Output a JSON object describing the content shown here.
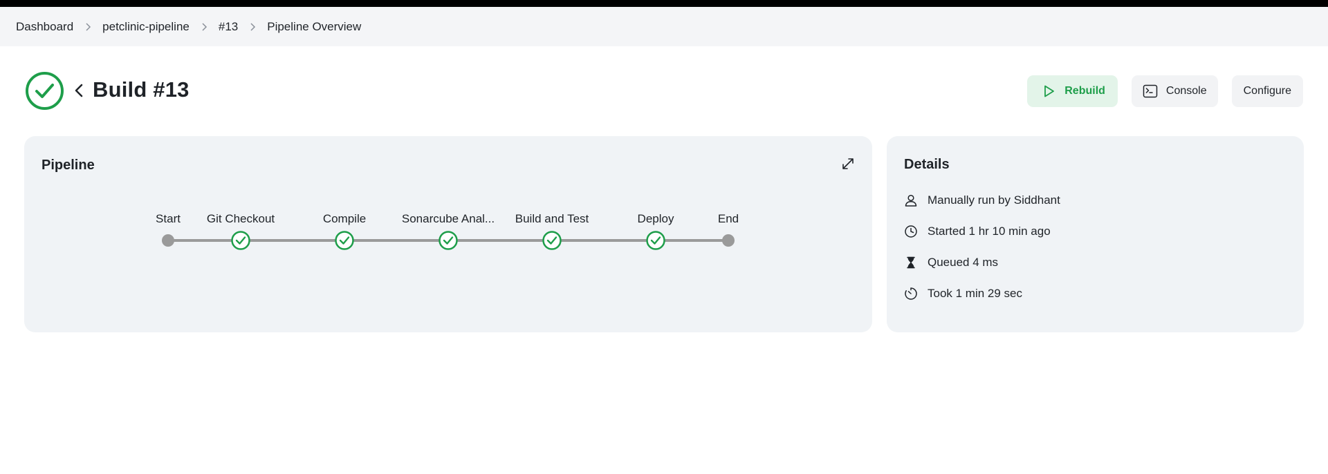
{
  "breadcrumb": [
    "Dashboard",
    "petclinic-pipeline",
    "#13",
    "Pipeline Overview"
  ],
  "build": {
    "title": "Build #13",
    "status": "success",
    "status_color": "#1e9e4a"
  },
  "actions": {
    "rebuild": "Rebuild",
    "console": "Console",
    "configure": "Configure"
  },
  "pipeline": {
    "title": "Pipeline",
    "stages": [
      {
        "label": "Start",
        "type": "terminal"
      },
      {
        "label": "Git Checkout",
        "type": "success"
      },
      {
        "label": "Compile",
        "type": "success"
      },
      {
        "label": "Sonarcube Anal...",
        "type": "success"
      },
      {
        "label": "Build and Test",
        "type": "success"
      },
      {
        "label": "Deploy",
        "type": "success"
      },
      {
        "label": "End",
        "type": "terminal"
      }
    ]
  },
  "details": {
    "title": "Details",
    "items": [
      {
        "icon": "user-icon",
        "text": "Manually run by Siddhant"
      },
      {
        "icon": "clock-icon",
        "text": "Started 1 hr 10 min ago"
      },
      {
        "icon": "hourglass-icon",
        "text": "Queued 4 ms"
      },
      {
        "icon": "timer-icon",
        "text": "Took 1 min 29 sec"
      }
    ]
  }
}
